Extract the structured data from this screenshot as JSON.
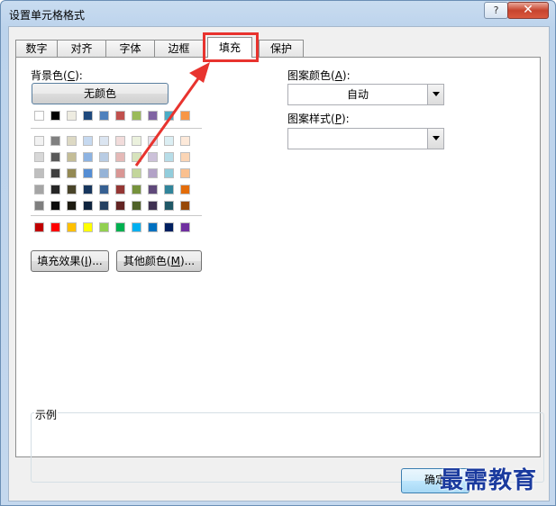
{
  "window": {
    "title": "设置单元格格式",
    "help": "?",
    "close": "✕"
  },
  "tabs": [
    "数字",
    "对齐",
    "字体",
    "边框",
    "填充",
    "保护"
  ],
  "active_tab": "填充",
  "background": {
    "label": "背景色(C):",
    "no_color": "无颜色",
    "theme_row": [
      "#FFFFFF",
      "#000000",
      "#EEECE1",
      "#1F497D",
      "#4F81BD",
      "#C0504D",
      "#9BBB59",
      "#8064A2",
      "#4BACC6",
      "#F79646"
    ],
    "tint_rows": [
      [
        "#F2F2F2",
        "#808080",
        "#DDD9C4",
        "#C6D9F0",
        "#DBE5F1",
        "#F2DCDB",
        "#EBF1DD",
        "#E5E0EC",
        "#DBEEF3",
        "#FDE9D9"
      ],
      [
        "#D8D8D8",
        "#595959",
        "#C4BD97",
        "#8DB3E2",
        "#B8CCE4",
        "#E5B9B7",
        "#D7E3BC",
        "#CCC1D9",
        "#B7DDE8",
        "#FBD5B5"
      ],
      [
        "#BFBFBF",
        "#3F3F3F",
        "#938953",
        "#548DD4",
        "#95B3D7",
        "#D99694",
        "#C3D69B",
        "#B2A2C7",
        "#92CDDC",
        "#FAC08F"
      ],
      [
        "#A5A5A5",
        "#262626",
        "#494429",
        "#17365D",
        "#366092",
        "#953734",
        "#76923C",
        "#5F497A",
        "#31859B",
        "#E36C09"
      ],
      [
        "#7F7F7F",
        "#0C0C0C",
        "#1D1B10",
        "#0F243E",
        "#244061",
        "#632423",
        "#4F6128",
        "#3F3151",
        "#205867",
        "#974806"
      ]
    ],
    "standard_row": [
      "#C00000",
      "#FF0000",
      "#FFC000",
      "#FFFF00",
      "#92D050",
      "#00B050",
      "#00B0F0",
      "#0070C0",
      "#002060",
      "#7030A0"
    ],
    "fill_effects": "填充效果(I)...",
    "more_colors": "其他颜色(M)..."
  },
  "pattern": {
    "color_label": "图案颜色(A):",
    "color_value": "自动",
    "style_label": "图案样式(P):",
    "style_value": ""
  },
  "sample": {
    "label": "示例"
  },
  "buttons": {
    "ok": "确定"
  },
  "watermark": "最需教育",
  "annotation_color": "#E8332E"
}
